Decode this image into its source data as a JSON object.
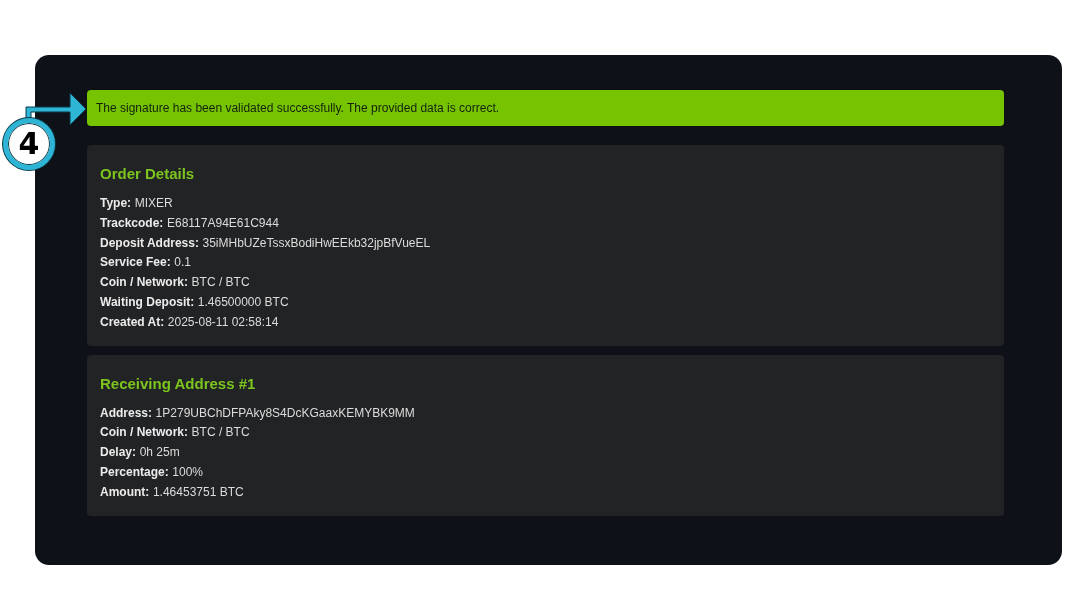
{
  "callout": {
    "number": "4"
  },
  "alert": {
    "text": "The signature has been validated successfully. The provided data is correct."
  },
  "cards": [
    {
      "title": "Order Details",
      "fields": [
        {
          "label": "Type:",
          "value": "MIXER"
        },
        {
          "label": "Trackcode:",
          "value": "E68117A94E61C944"
        },
        {
          "label": "Deposit Address:",
          "value": "35iMHbUZeTssxBodiHwEEkb32jpBfVueEL"
        },
        {
          "label": "Service Fee:",
          "value": "0.1"
        },
        {
          "label": "Coin / Network:",
          "value": "BTC / BTC"
        },
        {
          "label": "Waiting Deposit:",
          "value": "1.46500000 BTC"
        },
        {
          "label": "Created At:",
          "value": "2025-08-11 02:58:14"
        }
      ]
    },
    {
      "title": "Receiving Address #1",
      "fields": [
        {
          "label": "Address:",
          "value": "1P279UBChDFPAky8S4DcKGaaxKEMYBK9MM"
        },
        {
          "label": "Coin / Network:",
          "value": "BTC / BTC"
        },
        {
          "label": "Delay:",
          "value": "0h 25m"
        },
        {
          "label": "Percentage:",
          "value": "100%"
        },
        {
          "label": "Amount:",
          "value": "1.46453751 BTC"
        }
      ]
    }
  ]
}
